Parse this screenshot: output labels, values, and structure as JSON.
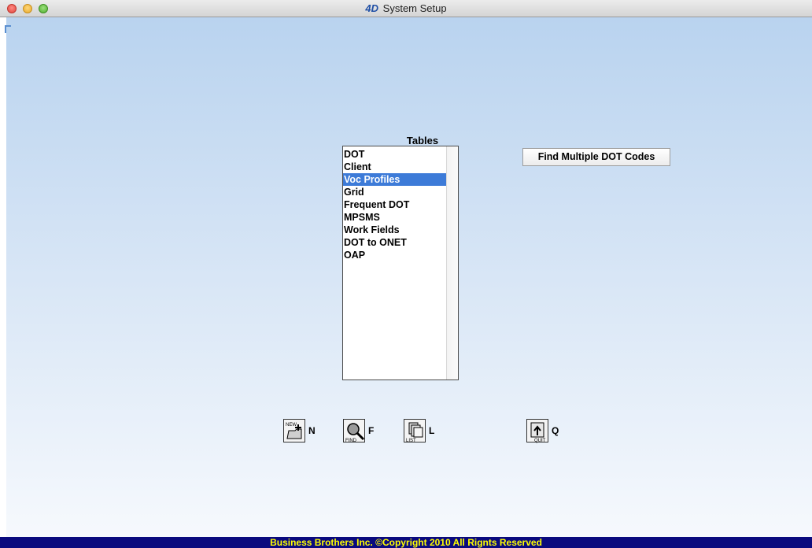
{
  "window": {
    "title": "System Setup",
    "logo": "4D"
  },
  "tables": {
    "label": "Tables",
    "items": [
      "DOT",
      "Client",
      "Voc Profiles",
      "Grid",
      "Frequent DOT",
      "MPSMS",
      "Work Fields",
      "DOT to ONET",
      "OAP"
    ],
    "selected": "Voc Profiles"
  },
  "buttons": {
    "find_multiple": "Find Multiple DOT Codes"
  },
  "toolbar": {
    "new": {
      "key": "N",
      "icon": "new-record-icon",
      "icon_text": "NEW"
    },
    "find": {
      "key": "F",
      "icon": "find-icon",
      "icon_text": "FIND"
    },
    "list": {
      "key": "L",
      "icon": "list-icon",
      "icon_text": "LIST"
    },
    "quit": {
      "key": "Q",
      "icon": "quit-icon",
      "icon_text": "QUIT"
    }
  },
  "footer": {
    "text": "Business Brothers Inc.  ©Copyright 2010 All Rignts Reserved"
  },
  "colors": {
    "selection": "#3d7bd8",
    "footer_bg": "#0a0a7e",
    "footer_text": "#ffff00"
  }
}
